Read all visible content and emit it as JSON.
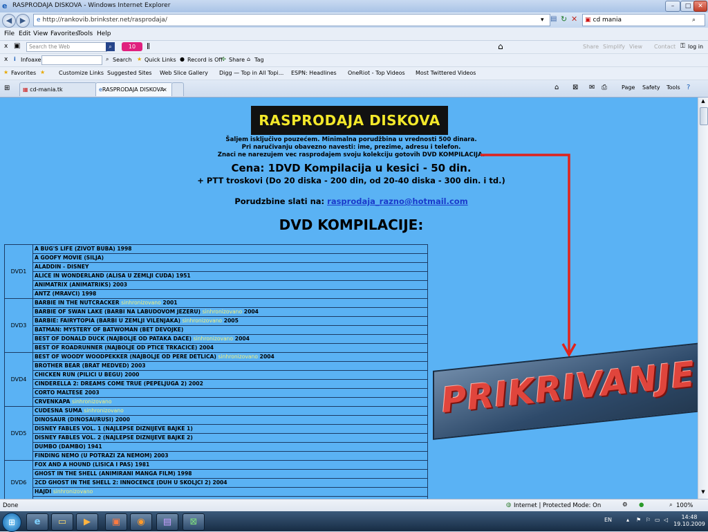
{
  "window": {
    "title": "RASPRODAJA DISKOVA - Windows Internet Explorer",
    "minimize": "–",
    "maximize": "□",
    "close": "✕"
  },
  "address": {
    "url": "http://rankovib.brinkster.net/rasprodaja/",
    "search_value": "cd mania"
  },
  "menu": [
    "File",
    "Edit",
    "View",
    "Favorites",
    "Tools",
    "Help"
  ],
  "toolbar1": {
    "search_placeholder": "Search the Web",
    "count": "10",
    "items": [
      "Share",
      "Simplify",
      "View",
      "Contact"
    ],
    "login": "log in"
  },
  "toolbar2": {
    "items": [
      "Infoaxe",
      "Search",
      "Quick Links",
      "Record is Off",
      "Share",
      "Tag"
    ]
  },
  "favorites_bar": {
    "items": [
      "Favorites",
      "Customize Links",
      "Suggested Sites",
      "Web Slice Gallery",
      "Digg — Top in All Topi...",
      "ESPN: Headlines",
      "OneRiot - Top Videos",
      "Most Twittered Videos"
    ]
  },
  "tabs": [
    {
      "label": "cd-mania.tk"
    },
    {
      "label": "RASPRODAJA DISKOVA"
    }
  ],
  "command_bar": {
    "items": [
      "Page",
      "Safety",
      "Tools"
    ]
  },
  "page": {
    "banner": "RASPRODAJA DISKOVA",
    "lines": [
      "Šaljem isključivo pouzećem. Minimalna porudžbina u vrednosti 500 dinara.",
      "Pri naručivanju obavezno navesti: ime, prezime, adresu i telefon.",
      "Znaci ne narezujem vec rasprodajem svoju kolekciju gotovih DVD KOMPILACIJA."
    ],
    "price": "Cena: 1DVD Kompilacija u kesici - 50 din.",
    "ptt": "+ PTT troskovi (Do 20 diska - 200 din, od 20-40 diska - 300 din. i td.)",
    "order_label": "Porudzbine slati na:",
    "order_email": "rasprodaja_razno@hotmail.com",
    "section_title": "DVD KOMPILACIJE:",
    "sync_word": "sinhronizovano",
    "groups": [
      {
        "dvd": "DVD1",
        "rows": [
          {
            "t": "A BUG'S LIFE (ZIVOT BUBA) 1998"
          },
          {
            "t": "A GOOFY MOVIE (SILJA)"
          },
          {
            "t": "ALADDIN - DISNEY"
          },
          {
            "t": "ALICE IN WONDERLAND (ALISA U ZEMLJI CUDA) 1951"
          },
          {
            "t": "ANIMATRIX (ANIMATRIKS) 2003"
          },
          {
            "t": "ANTZ (MRAVCI) 1998"
          }
        ]
      },
      {
        "dvd": "DVD3",
        "rows": [
          {
            "t": "BARBIE IN THE NUTCRACKER",
            "s": "sinhronizovano",
            "y": "2001"
          },
          {
            "t": "BARBIE OF SWAN LAKE (BARBI NA LABUDOVOM JEZERU)",
            "s": "sinhronizovano",
            "y": "2004"
          },
          {
            "t": "BARBIE: FAIRYTOPIA (BARBI U ZEMLJI VILENJAKA)",
            "s": "sinhronizovano",
            "y": "2005"
          },
          {
            "t": "BATMAN: MYSTERY OF BATWOMAN (BET DEVOJKE)"
          },
          {
            "t": "BEST OF DONALD DUCK (NAJBOLJE OD PATAKA DACE)",
            "s": "sinhronizovano",
            "y": "2004"
          },
          {
            "t": "BEST OF ROADRUNNER (NAJBOLJE OD PTICE TRKACICE) 2004"
          }
        ]
      },
      {
        "dvd": "DVD4",
        "rows": [
          {
            "t": "BEST OF WOODY WOODPEKKER (NAJBOLJE OD PERE DETLICA)",
            "s": "sinhronizovano",
            "y": "2004"
          },
          {
            "t": "BROTHER BEAR (BRAT MEDVED) 2003"
          },
          {
            "t": "CHICKEN RUN (PILICI U BEGU) 2000"
          },
          {
            "t": "CINDERELLA 2: DREAMS COME TRUE (PEPELJUGA 2) 2002"
          },
          {
            "t": "CORTO MALTESE 2003"
          },
          {
            "t": "CRVENKAPA",
            "s": "sinhronizovano"
          }
        ]
      },
      {
        "dvd": "DVD5",
        "rows": [
          {
            "t": "CUDESNA SUMA",
            "s": "sinhronizovano"
          },
          {
            "t": "DINOSAUR (DINOSAURUSI) 2000"
          },
          {
            "t": "DISNEY FABLES VOL. 1 (NAJLEPSE DIZNIJEVE BAJKE 1)"
          },
          {
            "t": "DISNEY FABLES VOL. 2 (NAJLEPSE DIZNIJEVE BAJKE 2)"
          },
          {
            "t": "DUMBO (DAMBO) 1941"
          },
          {
            "t": "FINDING NEMO (U POTRAZI ZA NEMOM) 2003"
          }
        ]
      },
      {
        "dvd": "DVD6",
        "rows": [
          {
            "t": "FOX AND A HOUND (LISICA I PAS) 1981"
          },
          {
            "t": "GHOST IN THE SHELL (ANIMIRANI MANGA FILM) 1998"
          },
          {
            "t": "2CD GHOST IN THE SHELL 2: INNOCENCE (DUH U SKOLJCI 2) 2004"
          },
          {
            "t": "HAJDI",
            "s": "sinhronizovano"
          },
          {
            "t": ""
          }
        ]
      }
    ],
    "overlay_text": "PRIKRIVANJE"
  },
  "status": {
    "left": "Done",
    "zone": "Internet | Protected Mode: On",
    "zoom": "100%"
  },
  "taskbar": {
    "lang": "EN",
    "time": "14:48",
    "date": "19.10.2009"
  },
  "colors": {
    "page_bg": "#5ab2f4",
    "banner_bg": "#111111",
    "banner_text": "#f3e82a",
    "sync_text": "#f4f07a",
    "arrow": "#e0231b",
    "overlay_text": "#e0453c"
  }
}
